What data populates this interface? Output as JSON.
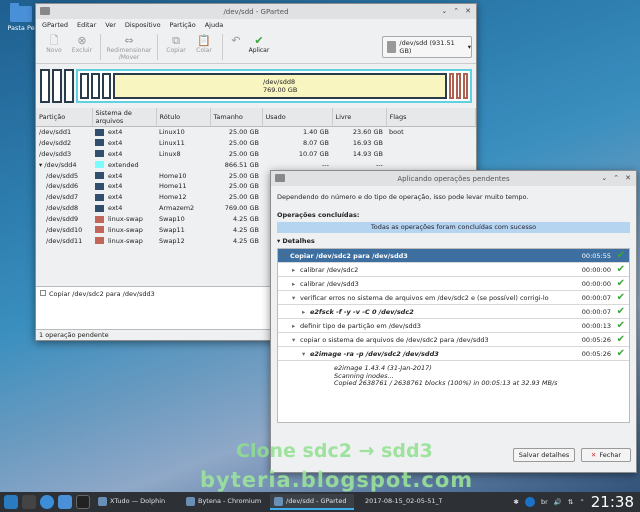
{
  "desktop": {
    "icon_label": "Pasta Pe",
    "watermark1": "Clone sdc2 → sdd3",
    "watermark2": "byteria.blogspot.com"
  },
  "gparted": {
    "title": "/dev/sdd - GParted",
    "menu": [
      "GParted",
      "Editar",
      "Ver",
      "Dispositivo",
      "Partição",
      "Ajuda"
    ],
    "tools": [
      {
        "icon": "new",
        "label": "Novo"
      },
      {
        "icon": "delete",
        "label": "Excluir"
      },
      {
        "icon": "resize",
        "label": "Redimensionar\n/Mover"
      },
      {
        "icon": "copy",
        "label": "Copiar"
      },
      {
        "icon": "paste",
        "label": "Colar"
      },
      {
        "icon": "undo",
        "label": ""
      },
      {
        "icon": "apply",
        "label": "Aplicar"
      }
    ],
    "device": "/dev/sdd  (931.51 GB)",
    "map": {
      "name": "/dev/sdd8",
      "size": "769.00 GB"
    },
    "columns": [
      "Partição",
      "Sistema de arquivos",
      "Rótulo",
      "Tamanho",
      "Usado",
      "Livre",
      "Flags"
    ],
    "rows": [
      {
        "part": "/dev/sdd1",
        "fs": "ext4",
        "color": "#314e6c",
        "label": "Linux10",
        "size": "25.00 GB",
        "used": "1.40 GB",
        "free": "23.60 GB",
        "flags": "boot"
      },
      {
        "part": "/dev/sdd2",
        "fs": "ext4",
        "color": "#314e6c",
        "label": "Linux11",
        "size": "25.00 GB",
        "used": "8.07 GB",
        "free": "16.93 GB",
        "flags": ""
      },
      {
        "part": "/dev/sdd3",
        "fs": "ext4",
        "color": "#314e6c",
        "label": "Linux8",
        "size": "25.00 GB",
        "used": "10.07 GB",
        "free": "14.93 GB",
        "flags": ""
      },
      {
        "part": "/dev/sdd4",
        "fs": "extended",
        "color": "#7dfcfe",
        "label": "",
        "size": "866.51 GB",
        "used": "---",
        "free": "---",
        "flags": ""
      },
      {
        "part": "/dev/sdd5",
        "fs": "ext4",
        "color": "#314e6c",
        "label": "Home10",
        "size": "25.00 GB",
        "used": "",
        "free": "",
        "flags": ""
      },
      {
        "part": "/dev/sdd6",
        "fs": "ext4",
        "color": "#314e6c",
        "label": "Home11",
        "size": "25.00 GB",
        "used": "",
        "free": "",
        "flags": ""
      },
      {
        "part": "/dev/sdd7",
        "fs": "ext4",
        "color": "#314e6c",
        "label": "Home12",
        "size": "25.00 GB",
        "used": "",
        "free": "",
        "flags": ""
      },
      {
        "part": "/dev/sdd8",
        "fs": "ext4",
        "color": "#314e6c",
        "label": "Armazem2",
        "size": "769.00 GB",
        "used": "",
        "free": "",
        "flags": ""
      },
      {
        "part": "/dev/sdd9",
        "fs": "linux-swap",
        "color": "#c1665a",
        "label": "Swap10",
        "size": "4.25 GB",
        "used": "",
        "free": "",
        "flags": ""
      },
      {
        "part": "/dev/sdd10",
        "fs": "linux-swap",
        "color": "#c1665a",
        "label": "Swap11",
        "size": "4.25 GB",
        "used": "",
        "free": "",
        "flags": ""
      },
      {
        "part": "/dev/sdd11",
        "fs": "linux-swap",
        "color": "#c1665a",
        "label": "Swap12",
        "size": "4.25 GB",
        "used": "",
        "free": "",
        "flags": ""
      }
    ],
    "pending_item": "Copiar /dev/sdc2 para /dev/sdd3",
    "status": "1 operação pendente"
  },
  "dialog": {
    "title": "Aplicando operações pendentes",
    "intro": "Dependendo do número e do tipo de operação, isso pode levar muito tempo.",
    "completed_label": "Operações concluídas:",
    "banner": "Todas as operações foram concluídas com sucesso",
    "details_label": "Detalhes",
    "rows": [
      {
        "indent": 0,
        "arrow": "▾",
        "text": "Copiar /dev/sdc2 para /dev/sdd3",
        "time": "00:05:55",
        "bold": true,
        "top": true
      },
      {
        "indent": 1,
        "arrow": "▸",
        "text": "calibrar /dev/sdc2",
        "time": "00:00:00"
      },
      {
        "indent": 1,
        "arrow": "▸",
        "text": "calibrar /dev/sdd3",
        "time": "00:00:00"
      },
      {
        "indent": 1,
        "arrow": "▾",
        "text": "verificar erros no sistema de arquivos em /dev/sdc2 e (se possível) corrigi-lo",
        "time": "00:00:07"
      },
      {
        "indent": 2,
        "arrow": "▸",
        "text": "e2fsck -f -y -v -C 0 /dev/sdc2",
        "time": "00:00:07",
        "bold": true,
        "italic": true
      },
      {
        "indent": 1,
        "arrow": "▸",
        "text": "definir tipo de partição em /dev/sdd3",
        "time": "00:00:13"
      },
      {
        "indent": 1,
        "arrow": "▾",
        "text": "copiar o sistema de arquivos de /dev/sdc2 para /dev/sdd3",
        "time": "00:05:26"
      },
      {
        "indent": 2,
        "arrow": "▾",
        "text": "e2image -ra -p /dev/sdc2 /dev/sdd3",
        "time": "00:05:26",
        "bold": true,
        "italic": true
      }
    ],
    "output": [
      "e2image 1.43.4 (31-Jan-2017)",
      "Scanning inodes...",
      "Copied 2638761 / 2638761 blocks (100%) in 00:05:13 at 32.93 MB/s"
    ],
    "save_label": "Salvar detalhes",
    "close_label": "Fechar"
  },
  "taskbar": {
    "tasks": [
      {
        "label": "XTudo — Dolphin",
        "active": false
      },
      {
        "label": "Bytena - Chromium",
        "active": false
      },
      {
        "label": "/dev/sdd - GParted",
        "active": true
      },
      {
        "label": "2017-08-15_02-05-51_T...",
        "active": false
      }
    ],
    "lang": "br",
    "clock": "21:38"
  }
}
